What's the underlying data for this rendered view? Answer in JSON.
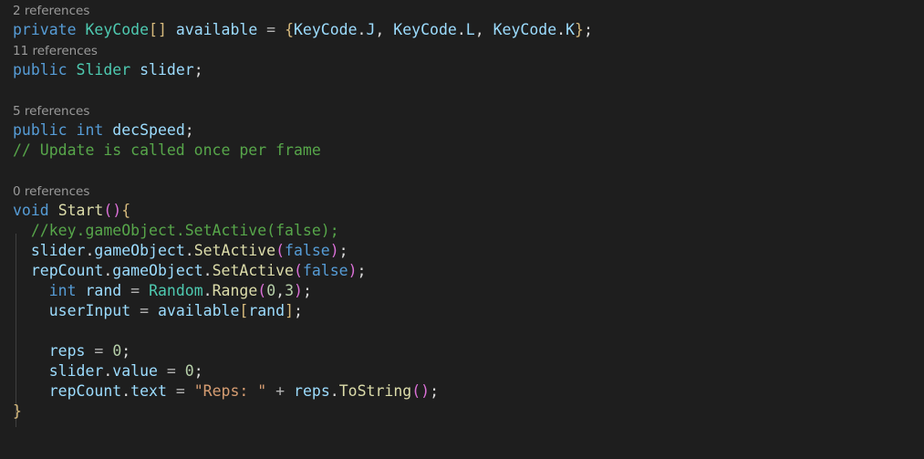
{
  "editor": {
    "language": "csharp",
    "background_color": "#1e1e1e",
    "theme": "dark-plus",
    "colors": {
      "keyword": "#569cd6",
      "type": "#4ec9b0",
      "variable": "#9cdcfe",
      "method": "#dcdcaa",
      "string": "#d69d72",
      "comment": "#57a64a",
      "number": "#b5cea8",
      "punctuation": "#dcdcdc",
      "brace": "#d7ba7d",
      "paren": "#da70d6",
      "codelens": "#9a9a9a"
    }
  },
  "code": {
    "lines": [
      {
        "kind": "codelens",
        "text": "2 references"
      },
      {
        "kind": "code",
        "text": "private KeyCode[] available = {KeyCode.J, KeyCode.L, KeyCode.K};"
      },
      {
        "kind": "codelens",
        "text": "11 references"
      },
      {
        "kind": "code",
        "text": "public Slider slider;"
      },
      {
        "kind": "blank",
        "text": ""
      },
      {
        "kind": "codelens",
        "text": "5 references"
      },
      {
        "kind": "code",
        "text": "public int decSpeed;"
      },
      {
        "kind": "code",
        "text": "// Update is called once per frame"
      },
      {
        "kind": "blank",
        "text": ""
      },
      {
        "kind": "codelens",
        "text": "0 references"
      },
      {
        "kind": "code",
        "text": "void Start(){"
      },
      {
        "kind": "code",
        "text": "  //key.gameObject.SetActive(false);"
      },
      {
        "kind": "code",
        "text": "  slider.gameObject.SetActive(false);"
      },
      {
        "kind": "code",
        "text": "  repCount.gameObject.SetActive(false);"
      },
      {
        "kind": "code",
        "text": "    int rand = Random.Range(0,3);"
      },
      {
        "kind": "code",
        "text": "    userInput = available[rand];"
      },
      {
        "kind": "blank",
        "text": ""
      },
      {
        "kind": "code",
        "text": "    reps = 0;"
      },
      {
        "kind": "code",
        "text": "    slider.value = 0;"
      },
      {
        "kind": "code",
        "text": "    repCount.text = \"Reps: \" + reps.ToString();"
      },
      {
        "kind": "code",
        "text": "}"
      }
    ],
    "codelens_labels": [
      "2 references",
      "11 references",
      "5 references",
      "0 references"
    ],
    "identifiers": [
      "available",
      "slider",
      "decSpeed",
      "Start",
      "key",
      "gameObject",
      "SetActive",
      "repCount",
      "rand",
      "Random",
      "Range",
      "userInput",
      "reps",
      "value",
      "text",
      "ToString"
    ],
    "types": [
      "KeyCode",
      "Slider"
    ],
    "keywords": [
      "private",
      "public",
      "int",
      "void",
      "false"
    ],
    "literals": [
      "KeyCode.J",
      "KeyCode.L",
      "KeyCode.K",
      "0",
      "3",
      "\"Reps: \""
    ],
    "comments": [
      "// Update is called once per frame",
      "//key.gameObject.SetActive(false);"
    ]
  }
}
